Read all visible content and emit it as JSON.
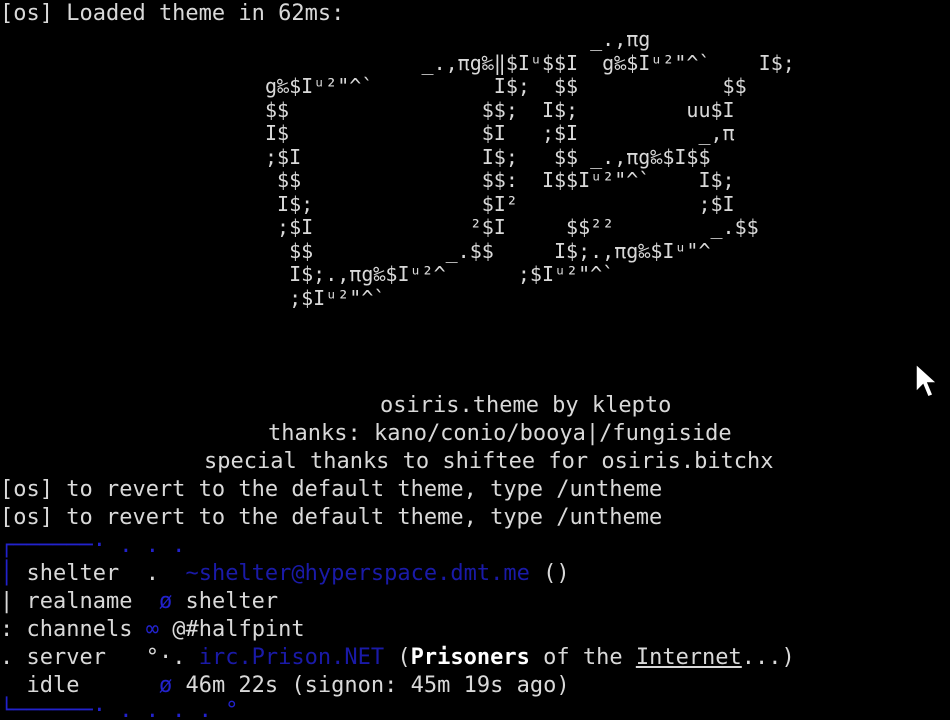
{
  "header_line": "[os] Loaded theme in 62ms:",
  "ascii_logo": [
    "                           _.,πg",
    "             _.,πg‰‖$Iᵘ$$I  g‰$Iᵘ²\"^`    I$;",
    "g‰$Iᵘ²\"^`          I$;  $$            $$",
    "$$                $$;  I$;         uu$I",
    "I$                $I   ;$I          _,π",
    ";$I               I$;   $$ _.,πg‰$I$$",
    " $$               $$:  I$$Iᵘ²\"^`    I$;",
    " I$;              $I²               ;$I",
    " ;$I             ²$I     $$²²        _.$$",
    "  $$           _.$$     I$;.,πg‰$Iᵘ\"^",
    "  I$;.,πg‰$Iᵘ²^      ;$Iᵘ²\"^`",
    "  ;$Iᵘ²\"^`"
  ],
  "credits": {
    "theme_line": "osiris.theme by klepto",
    "thanks_line": "thanks: kano/conio/booya|/fungiside",
    "special_line": "special thanks to shiftee for osiris.bitchx"
  },
  "revert_lines": [
    "[os] to revert to the default theme, type /untheme",
    "[os] to revert to the default theme, type /untheme"
  ],
  "whois": {
    "top_border": "┌──────· . . .",
    "nick_prefix": "│ ",
    "nick": "shelter",
    "nick_sep": "  .  ",
    "host": "~shelter@hyperspace.dmt.me",
    "host_suffix": " ()",
    "realname_prefix": "| ",
    "realname_label": "realname",
    "realname_sep": "  ø ",
    "realname_value": "shelter",
    "channels_prefix": ": ",
    "channels_label": "channels",
    "channels_sep": " ∞ ",
    "channels_value": "@#halfpint",
    "server_prefix": ". ",
    "server_label": "server",
    "server_sep": "   °·. ",
    "server_value": "irc.Prison.NET",
    "server_desc_open": " (",
    "server_desc_bold": "Prisoners",
    "server_desc_mid": " of the ",
    "server_desc_ul": "Internet",
    "server_desc_close": "...)",
    "idle_prefix": "  ",
    "idle_label": "idle",
    "idle_sep": "      ø ",
    "idle_value": "46m 22s (signon: 45m 19s ago)",
    "bottom_border": "└──────· . . . . °"
  },
  "colors": {
    "background": "#000000",
    "text": "#d9d9d9",
    "accent_blue": "#2222cc"
  }
}
